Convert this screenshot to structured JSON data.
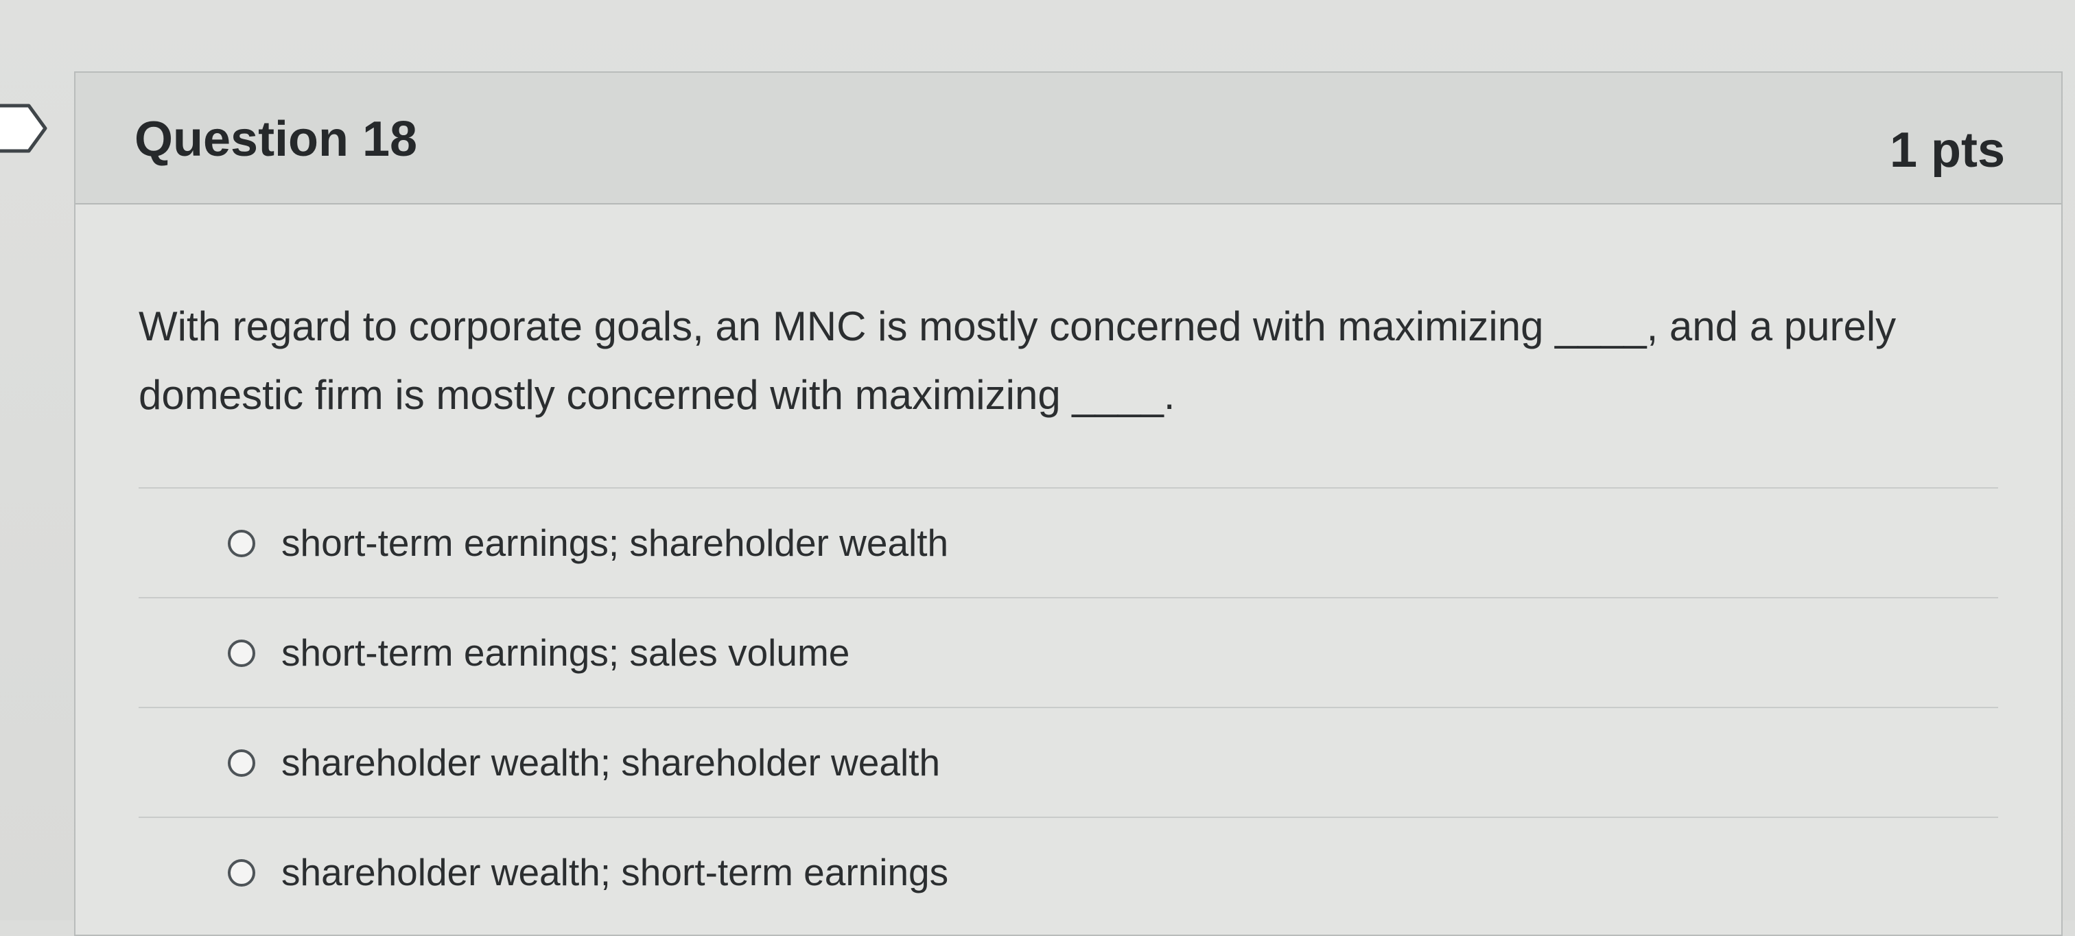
{
  "question": {
    "title": "Question 18",
    "points": "1 pts",
    "text": "With regard to corporate goals, an MNC is mostly concerned with maximizing ____, and a purely domestic firm is mostly concerned with maximizing ____.",
    "answers": [
      {
        "label": "short-term earnings; shareholder wealth",
        "selected": false
      },
      {
        "label": "short-term earnings; sales volume",
        "selected": false
      },
      {
        "label": "shareholder wealth; shareholder wealth",
        "selected": false
      },
      {
        "label": "shareholder wealth; short-term earnings",
        "selected": false
      }
    ]
  },
  "icons": {
    "bookmark": "bookmark-flag-icon"
  },
  "colors": {
    "header_bg": "#d6d8d6",
    "card_bg": "#e3e4e2",
    "text": "#2b2e30"
  }
}
